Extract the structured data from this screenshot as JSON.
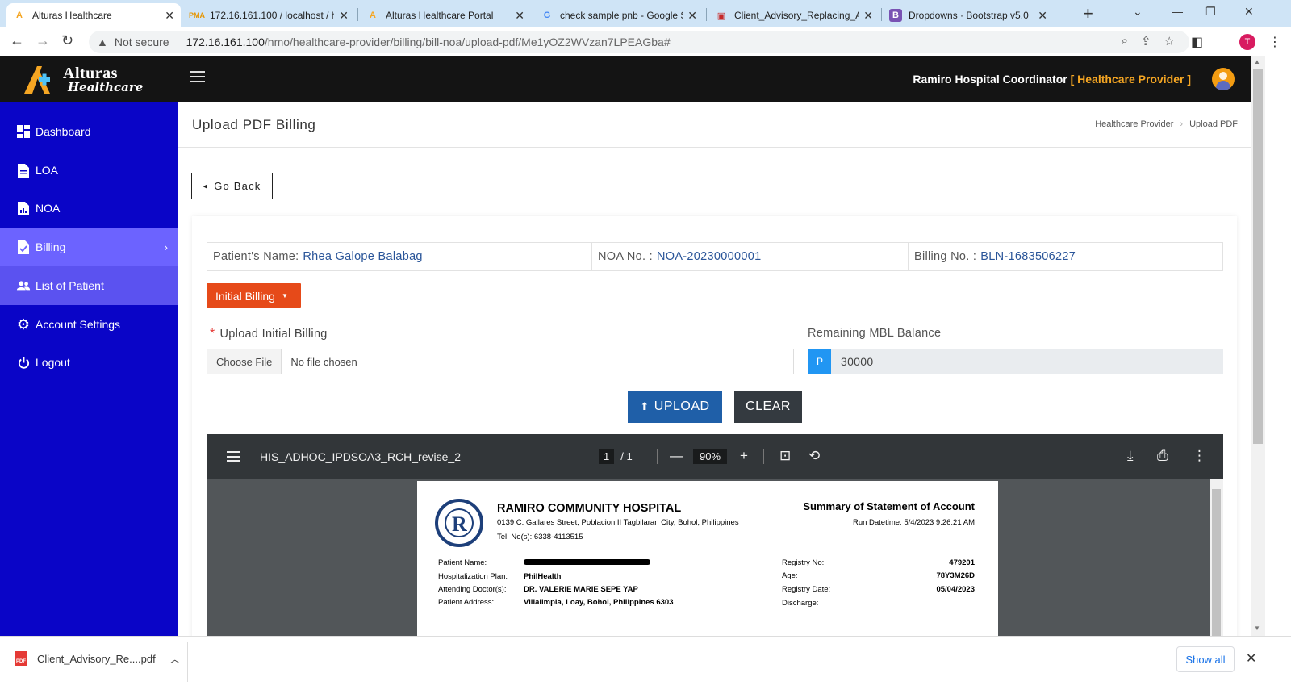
{
  "browser": {
    "tabs": [
      {
        "title": "Alturas Healthcare",
        "active": true
      },
      {
        "title": "172.16.161.100 / localhost / h"
      },
      {
        "title": "Alturas Healthcare Portal"
      },
      {
        "title": "check sample pnb - Google S"
      },
      {
        "title": "Client_Advisory_Replacing_AE"
      },
      {
        "title": "Dropdowns · Bootstrap v5.0"
      }
    ],
    "security_label": "Not secure",
    "url_host": "172.16.161.100",
    "url_path": "/hmo/healthcare-provider/billing/bill-noa/upload-pdf/Me1yOZ2WVzan7LPEAGba#",
    "profile_initial": "T"
  },
  "header": {
    "logo_line1": "Alturas",
    "logo_line2": "Healthcare",
    "user_name": "Ramiro Hospital Coordinator",
    "user_role": "[ Healthcare Provider ]"
  },
  "sidebar": {
    "items": [
      {
        "label": "Dashboard"
      },
      {
        "label": "LOA"
      },
      {
        "label": "NOA"
      },
      {
        "label": "Billing"
      },
      {
        "label": "List of Patient"
      },
      {
        "label": "Account Settings"
      },
      {
        "label": "Logout"
      }
    ]
  },
  "page": {
    "title": "Upload PDF Billing",
    "breadcrumb": [
      "Healthcare Provider",
      "Upload PDF"
    ],
    "go_back": "Go Back"
  },
  "patient": {
    "name_label": "Patient's Name:",
    "name_value": "Rhea Galope Balabag",
    "noa_label": "NOA No. :",
    "noa_value": "NOA-20230000001",
    "billing_label": "Billing No. :",
    "billing_value": "BLN-1683506227"
  },
  "form": {
    "billing_type": "Initial Billing",
    "upload_label": "Upload Initial Billing",
    "choose_file": "Choose File",
    "no_file": "No file chosen",
    "balance_label": "Remaining MBL Balance",
    "currency": "P",
    "balance_value": "30000",
    "upload_button": "UPLOAD",
    "clear_button": "CLEAR"
  },
  "pdf": {
    "filename": "HIS_ADHOC_IPDSOA3_RCH_revise_2",
    "page_current": "1",
    "page_total": "/ 1",
    "zoom": "90%",
    "hospital_name": "RAMIRO COMMUNITY HOSPITAL",
    "hospital_address": "0139 C. Gallares Street, Poblacion II Tagbilaran City, Bohol, Philippines",
    "hospital_tel": "Tel. No(s): 6338-4113515",
    "doc_title": "Summary of Statement of Account",
    "run_datetime": "Run Datetime: 5/4/2023 9:26:21 AM",
    "left_fields": [
      {
        "label": "Patient Name:",
        "value": ""
      },
      {
        "label": "Hospitalization Plan:",
        "value": "PhilHealth"
      },
      {
        "label": "Attending Doctor(s):",
        "value": "DR. VALERIE MARIE SEPE YAP"
      },
      {
        "label": "Patient Address:",
        "value": "Villalimpia, Loay, Bohol, Philippines 6303"
      }
    ],
    "right_fields": [
      {
        "label": "Registry No:",
        "value": "479201"
      },
      {
        "label": "Age:",
        "value": "78Y3M26D"
      },
      {
        "label": "Registry Date:",
        "value": "05/04/2023"
      },
      {
        "label": "Discharge:",
        "value": ""
      }
    ]
  },
  "downloads": {
    "file": "Client_Advisory_Re....pdf",
    "show_all": "Show all"
  }
}
